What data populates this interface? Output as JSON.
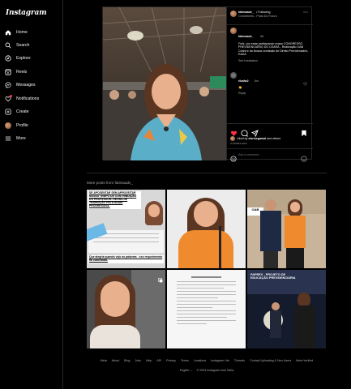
{
  "app": {
    "logo": "Instagram"
  },
  "sidebar": {
    "items": [
      {
        "label": "Home"
      },
      {
        "label": "Search"
      },
      {
        "label": "Explore"
      },
      {
        "label": "Reels"
      },
      {
        "label": "Messages"
      },
      {
        "label": "Notifications"
      },
      {
        "label": "Create"
      },
      {
        "label": "Profile"
      },
      {
        "label": "More"
      }
    ]
  },
  "post": {
    "username": "fatimaadv_",
    "verified_mark": "",
    "follow_label": "• Following",
    "location": "Crecimiento - Praia Do Futuro",
    "caption_user": "fatimaadv_",
    "caption_time": "8d",
    "caption_text": "Feliz, por estar participando nosso CONGRESSO PREVIDENCIÁRIO DO CEARÁ - Realização OAB Ceará e da Nossa comissão de Direito Previdenciário, EADA",
    "see_translation": "See translation",
    "comment_user": "ribafw2",
    "comment_time": "6m",
    "comment_text": "👏",
    "reply_label": "Reply",
    "liked_by_prefix": "Liked by",
    "liked_by_user": "clarisegamal",
    "liked_by_suffix": "and others",
    "date": "4 HOURS AGO",
    "comment_placeholder": "Add a comment..."
  },
  "more": {
    "title": "More posts from fatimaadv_",
    "tile1_text_top": "SE APOSENTAR SEM APROVEITAR NOSSO TEMPO DE CONTRIBUIÇÃO DO PROFESSOR- REGRA DE TRANSIÇÃO PELA IDADE PROGRESSIVA.",
    "tile1_text_bottom": "Que alegria quando vejo as palavras : seu requerimento foi concedido.",
    "tile9_text": "PAPREV - PROJETO DE EDUCAÇÃO PREVIDENCIÁRIA"
  },
  "footer": {
    "links": [
      "Meta",
      "About",
      "Blog",
      "Jobs",
      "Help",
      "API",
      "Privacy",
      "Terms",
      "Locations",
      "Instagram Lite",
      "Threads",
      "Contact Uploading & Non-Users",
      "Meta Verified"
    ],
    "lang": "English",
    "copyright": "© 2023 Instagram from Meta"
  },
  "colors": {
    "accent_red": "#ff3040",
    "link_blue": "#0095f6"
  }
}
